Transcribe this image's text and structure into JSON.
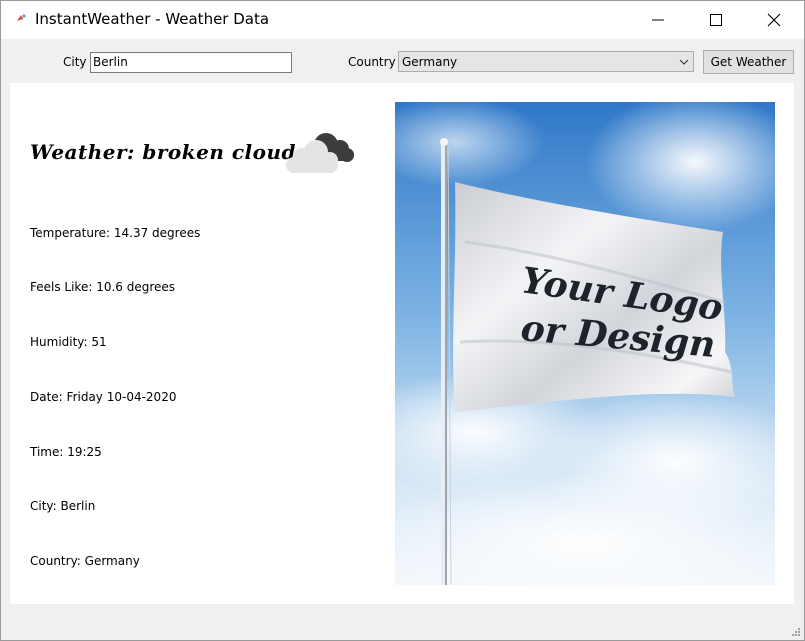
{
  "window": {
    "title": "InstantWeather - Weather Data"
  },
  "toolbar": {
    "city_label": "City",
    "city_value": "Berlin",
    "country_label": "Country",
    "country_value": "Germany",
    "get_weather_label": "Get Weather"
  },
  "weather": {
    "title": "Weather: broken clouds",
    "icon": "broken-clouds-icon",
    "temperature": "Temperature: 14.37 degrees",
    "feels_like": "Feels Like: 10.6 degrees",
    "humidity": "Humidity: 51",
    "date": "Date: Friday 10-04-2020",
    "time": "Time: 19:25",
    "city": "City: Berlin",
    "country": "Country: Germany"
  },
  "flag": {
    "text_line1": "Your Logo",
    "text_line2": "or Design"
  },
  "colors": {
    "sky_top": "#2f78c8",
    "sky_bottom": "#eaf2fa",
    "cloud_dark": "#3a3a3a",
    "cloud_light": "#e6e6e6"
  }
}
